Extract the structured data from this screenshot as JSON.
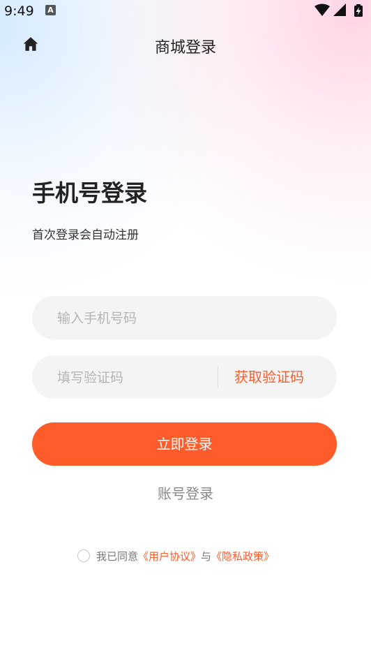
{
  "status_bar": {
    "time": "9:49",
    "notification_badge": "A",
    "icons": [
      "wifi-icon",
      "cellular-signal-icon",
      "battery-charging-icon"
    ]
  },
  "header": {
    "home_icon": "home-icon",
    "title": "商城登录"
  },
  "login": {
    "heading": "手机号登录",
    "subheading": "首次登录会自动注册",
    "phone_placeholder": "输入手机号码",
    "phone_value": "",
    "code_placeholder": "填写验证码",
    "code_value": "",
    "get_code_label": "获取验证码",
    "submit_label": "立即登录",
    "account_login_label": "账号登录"
  },
  "agreement": {
    "checked": false,
    "prefix": "我已同意",
    "user_agreement_link": "《用户协议》",
    "connector": "与",
    "privacy_policy_link": "《隐私政策》"
  },
  "colors": {
    "accent": "#ff5c2b",
    "input_bg": "#f4f4f4",
    "placeholder": "#b5b5b5"
  }
}
